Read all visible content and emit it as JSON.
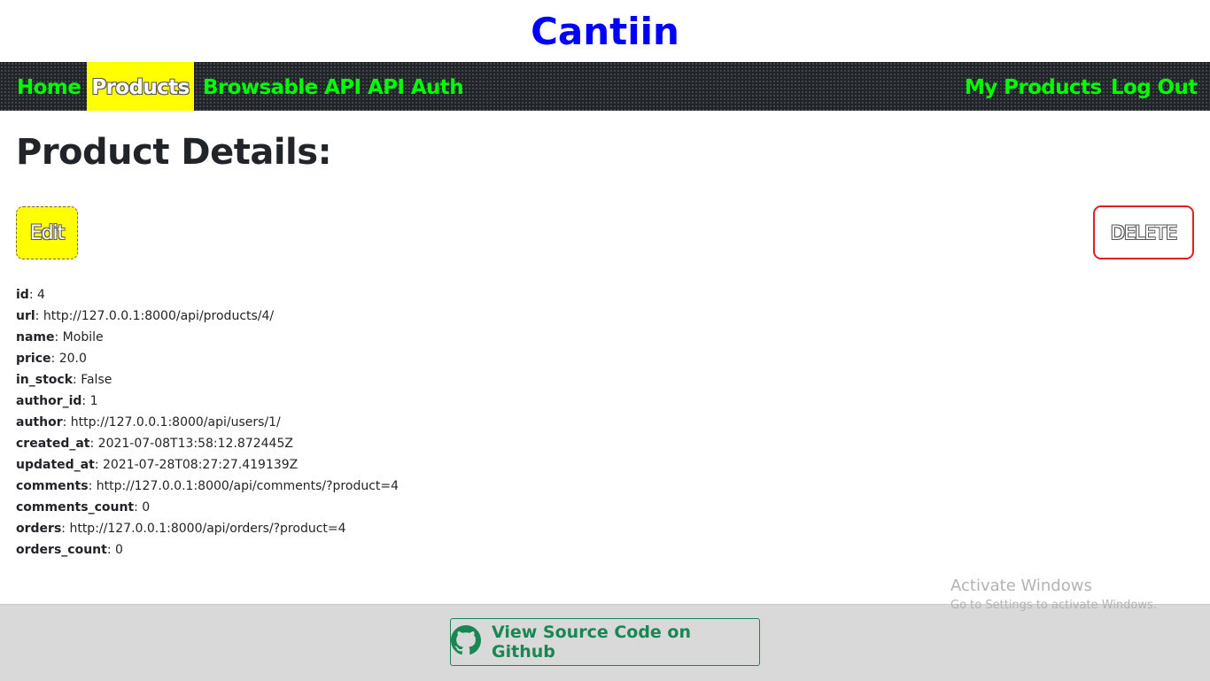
{
  "site": {
    "title": "Cantiin"
  },
  "nav": {
    "left": [
      {
        "label": "Home",
        "active": false
      },
      {
        "label": "Products",
        "active": true
      },
      {
        "label": "Browsable API",
        "active": false
      },
      {
        "label": "API Auth",
        "active": false
      }
    ],
    "right": [
      {
        "label": "My Products"
      },
      {
        "label": "Log Out"
      }
    ],
    "colors": {
      "bar": "#212529",
      "link": "#00ff00",
      "active_bg": "#ffff00"
    }
  },
  "page": {
    "heading": "Product Details:"
  },
  "actions": {
    "edit_label": "Edit",
    "delete_label": "DELETE"
  },
  "product": [
    {
      "key": "id",
      "value": "4"
    },
    {
      "key": "url",
      "value": "http://127.0.0.1:8000/api/products/4/"
    },
    {
      "key": "name",
      "value": "Mobile"
    },
    {
      "key": "price",
      "value": "20.0"
    },
    {
      "key": "in_stock",
      "value": "False"
    },
    {
      "key": "author_id",
      "value": "1"
    },
    {
      "key": "author",
      "value": "http://127.0.0.1:8000/api/users/1/"
    },
    {
      "key": "created_at",
      "value": "2021-07-08T13:58:12.872445Z"
    },
    {
      "key": "updated_at",
      "value": "2021-07-28T08:27:27.419139Z"
    },
    {
      "key": "comments",
      "value": "http://127.0.0.1:8000/api/comments/?product=4"
    },
    {
      "key": "comments_count",
      "value": "0"
    },
    {
      "key": "orders",
      "value": "http://127.0.0.1:8000/api/orders/?product=4"
    },
    {
      "key": "orders_count",
      "value": "0"
    }
  ],
  "watermark": {
    "title": "Activate Windows",
    "subtitle": "Go to Settings to activate Windows."
  },
  "footer": {
    "github_label": "View Source Code on Github",
    "github_icon": "github-icon"
  }
}
